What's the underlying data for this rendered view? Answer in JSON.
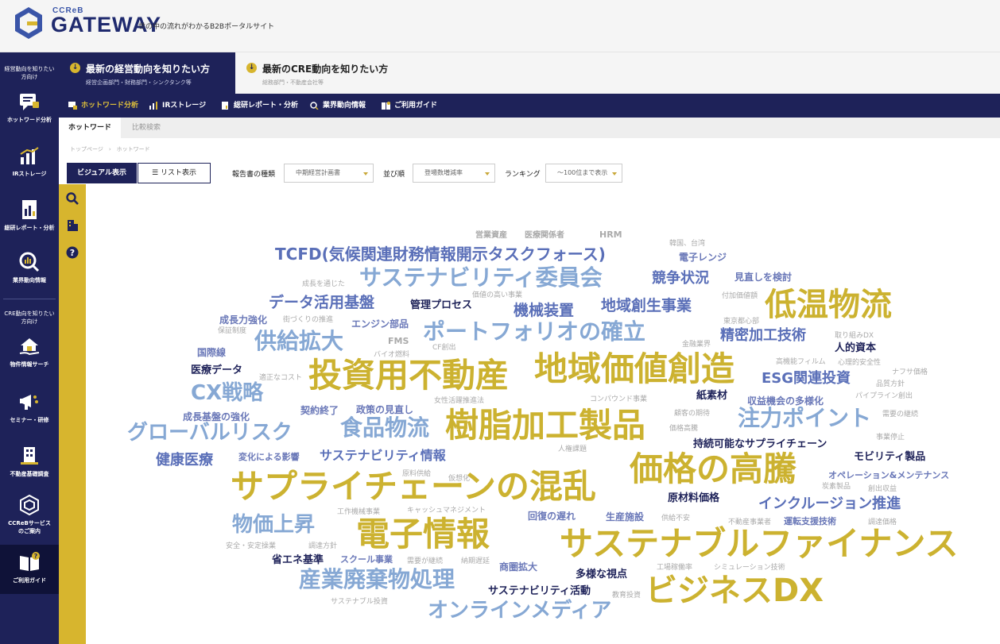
{
  "header": {
    "logo_small": "CCReB",
    "logo_main": "GATEWAY",
    "tagline": "世の中の流れがわかるB2Bポータルサイト"
  },
  "sidebar": {
    "caption_top": "経営動向を知りたい方向け",
    "caption_mid": "CRE動向を知りたい方向け",
    "items": [
      {
        "label": "ホットワード分析"
      },
      {
        "label": "IRストレージ"
      },
      {
        "label": "総研レポート・分析"
      },
      {
        "label": "業界動向情報"
      },
      {
        "label": "物件情報サーチ"
      },
      {
        "label": "セミナー・研修"
      },
      {
        "label": "不動産基礎調査"
      },
      {
        "label": "CCReBサービスのご案内"
      },
      {
        "label": "ご利用ガイド"
      }
    ]
  },
  "topic_tabs": [
    {
      "title": "最新の経営動向を知りたい方",
      "sub": "経営企画部門・財務部門・シンクタンク等"
    },
    {
      "title": "最新のCRE動向を知りたい方",
      "sub": "総務部門・不動産会社等"
    }
  ],
  "subnav": [
    "ホットワード分析",
    "IRストレージ",
    "総研レポート・分析",
    "業界動向情報",
    "ご利用ガイド"
  ],
  "subtabs": [
    "ホットワード",
    "比較検索"
  ],
  "breadcrumb": "トップページ　›　ホットワード",
  "controls": {
    "visual": "ビジュアル表示",
    "list": "リスト表示",
    "report_type_label": "報告書の種類",
    "report_type_value": "中期経営計画書",
    "order_label": "並び順",
    "order_value": "登場数増減率",
    "ranking_label": "ランキング",
    "ranking_value": "〜100位まで表示"
  },
  "colors": {
    "navy": "#1e2259",
    "gold": "#d7b52e",
    "word_gold": "#ccb230",
    "word_blue": "#5a7ab8",
    "word_light": "#8fb0d6",
    "word_gray": "#aaaaaa"
  },
  "words": [
    {
      "t": "投資用不動産",
      "c": "gold"
    },
    {
      "t": "地域価値創造",
      "c": "gold"
    },
    {
      "t": "樹脂加工製品",
      "c": "gold"
    },
    {
      "t": "価格の高騰",
      "c": "gold"
    },
    {
      "t": "サプライチェーンの混乱",
      "c": "gold"
    },
    {
      "t": "電子情報",
      "c": "gold"
    },
    {
      "t": "サステナブルファイナンス",
      "c": "gold"
    },
    {
      "t": "ビジネスDX",
      "c": "gold"
    },
    {
      "t": "低温物流",
      "c": "gold"
    },
    {
      "t": "TCFD(気候関連財務情報開示タスクフォース)",
      "c": "blue"
    },
    {
      "t": "サステナビリティ委員会",
      "c": "light"
    },
    {
      "t": "ポートフォリオの確立",
      "c": "light"
    },
    {
      "t": "供給拡大",
      "c": "light"
    },
    {
      "t": "CX戦略",
      "c": "light"
    },
    {
      "t": "グローバルリスク",
      "c": "light"
    },
    {
      "t": "食品物流",
      "c": "light"
    },
    {
      "t": "注力ポイント",
      "c": "light"
    },
    {
      "t": "物価上昇",
      "c": "light"
    },
    {
      "t": "産業廃棄物処理",
      "c": "light"
    },
    {
      "t": "オンラインメディア",
      "c": "light"
    },
    {
      "t": "データ活用基盤",
      "c": "blue"
    },
    {
      "t": "機械装置",
      "c": "blue"
    },
    {
      "t": "地域創生事業",
      "c": "blue"
    },
    {
      "t": "競争状況",
      "c": "blue"
    },
    {
      "t": "精密加工技術",
      "c": "blue"
    },
    {
      "t": "ESG関連投資",
      "c": "blue"
    },
    {
      "t": "健康医療",
      "c": "blue"
    },
    {
      "t": "サステナビリティ情報",
      "c": "blue"
    },
    {
      "t": "インクルージョン推進",
      "c": "blue"
    },
    {
      "t": "管理プロセス",
      "c": "navy"
    },
    {
      "t": "医療データ",
      "c": "navy"
    },
    {
      "t": "人的資本",
      "c": "navy"
    },
    {
      "t": "紙素材",
      "c": "navy"
    },
    {
      "t": "持続可能なサプライチェーン",
      "c": "navy"
    },
    {
      "t": "モビリティ製品",
      "c": "navy"
    },
    {
      "t": "原材料価格",
      "c": "navy"
    },
    {
      "t": "省エネ基準",
      "c": "navy"
    },
    {
      "t": "多様な視点",
      "c": "navy"
    },
    {
      "t": "サステナビリティ活動",
      "c": "navy"
    },
    {
      "t": "見直しを検討",
      "c": "mid"
    },
    {
      "t": "電子レンジ",
      "c": "mid"
    },
    {
      "t": "成長力強化",
      "c": "mid"
    },
    {
      "t": "契約終了",
      "c": "mid"
    },
    {
      "t": "成長基盤の強化",
      "c": "mid"
    },
    {
      "t": "収益機会の多様化",
      "c": "mid"
    },
    {
      "t": "生産施設",
      "c": "mid"
    },
    {
      "t": "回復の遅れ",
      "c": "mid"
    },
    {
      "t": "商圏拡大",
      "c": "mid"
    },
    {
      "t": "国際線",
      "c": "mid"
    },
    {
      "t": "エンジン部品",
      "c": "mid"
    },
    {
      "t": "政策の見直し",
      "c": "mid"
    },
    {
      "t": "変化による影響",
      "c": "mid"
    },
    {
      "t": "オペレーション&メンテナンス",
      "c": "mid"
    },
    {
      "t": "運転支援技術",
      "c": "mid"
    },
    {
      "t": "スクール事業",
      "c": "mid"
    },
    {
      "t": "営業資産",
      "c": "gray"
    },
    {
      "t": "医療関係者",
      "c": "gray"
    },
    {
      "t": "HRM",
      "c": "gray"
    },
    {
      "t": "韓国、台湾",
      "c": "gray"
    },
    {
      "t": "成長を通じた",
      "c": "gray"
    },
    {
      "t": "価値の高い事業",
      "c": "gray"
    },
    {
      "t": "付加価値額",
      "c": "gray"
    },
    {
      "t": "街づくりの推進",
      "c": "gray"
    },
    {
      "t": "保証制度",
      "c": "gray"
    },
    {
      "t": "東京都心部",
      "c": "gray"
    },
    {
      "t": "取り組みDX",
      "c": "gray"
    },
    {
      "t": "FMS",
      "c": "gray"
    },
    {
      "t": "CF創出",
      "c": "gray"
    },
    {
      "t": "金融業界",
      "c": "gray"
    },
    {
      "t": "高機能フィルム",
      "c": "gray"
    },
    {
      "t": "心理的安全性",
      "c": "gray"
    },
    {
      "t": "バイオ燃料",
      "c": "gray"
    },
    {
      "t": "適正なコスト",
      "c": "gray"
    },
    {
      "t": "ナフサ価格",
      "c": "gray"
    },
    {
      "t": "品質方針",
      "c": "gray"
    },
    {
      "t": "女性活躍推進法",
      "c": "gray"
    },
    {
      "t": "コンパウンド事業",
      "c": "gray"
    },
    {
      "t": "パイプライン創出",
      "c": "gray"
    },
    {
      "t": "顧客の期待",
      "c": "gray"
    },
    {
      "t": "需要の継続",
      "c": "gray"
    },
    {
      "t": "価格高騰",
      "c": "gray"
    },
    {
      "t": "事業停止",
      "c": "gray"
    },
    {
      "t": "人権課題",
      "c": "gray"
    },
    {
      "t": "原料供給",
      "c": "gray"
    },
    {
      "t": "仮想化",
      "c": "gray"
    },
    {
      "t": "炭素製品",
      "c": "gray"
    },
    {
      "t": "創出収益",
      "c": "gray"
    },
    {
      "t": "工作機械事業",
      "c": "gray"
    },
    {
      "t": "キャッシュマネジメント",
      "c": "gray"
    },
    {
      "t": "供給不安",
      "c": "gray"
    },
    {
      "t": "不動産事業者",
      "c": "gray"
    },
    {
      "t": "調達価格",
      "c": "gray"
    },
    {
      "t": "安全・安定操業",
      "c": "gray"
    },
    {
      "t": "調達方針",
      "c": "gray"
    },
    {
      "t": "需要が継続",
      "c": "gray"
    },
    {
      "t": "納期遅延",
      "c": "gray"
    },
    {
      "t": "工場稼働率",
      "c": "gray"
    },
    {
      "t": "シミュレーション技術",
      "c": "gray"
    },
    {
      "t": "教育投資",
      "c": "gray"
    },
    {
      "t": "サステナブル投資",
      "c": "gray"
    }
  ]
}
